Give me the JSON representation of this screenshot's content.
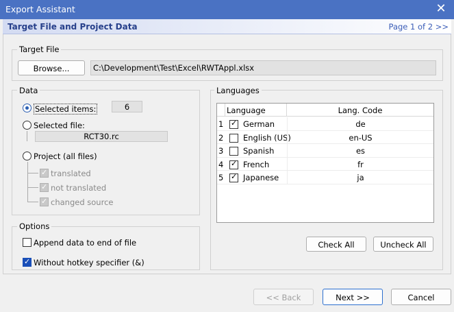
{
  "window": {
    "title": "Export Assistant",
    "close_glyph": "✕"
  },
  "header": {
    "title": "Target File and Project Data",
    "page": "Page 1 of 2",
    "page_arrow": ">>"
  },
  "target_file": {
    "label": "Target File",
    "browse_label": "Browse...",
    "path": "C:\\Development\\Test\\Excel\\RWTAppl.xlsx"
  },
  "data": {
    "label": "Data",
    "selected_items_label": "Selected items:",
    "selected_items_count": "6",
    "selected_file_label": "Selected file:",
    "selected_file_value": "RCT30.rc",
    "project_label": "Project (all files)",
    "translated_label": "translated",
    "not_translated_label": "not translated",
    "changed_source_label": "changed source",
    "selected_mode": "Selected items:"
  },
  "options": {
    "label": "Options",
    "append_label": "Append data to end of file",
    "append_checked": false,
    "hotkey_label": "Without hotkey specifier (&)",
    "hotkey_checked": true
  },
  "languages": {
    "label": "Languages",
    "col_language": "Language",
    "col_code": "Lang. Code",
    "rows": [
      {
        "num": "1",
        "checked": true,
        "name": "German",
        "code": "de"
      },
      {
        "num": "2",
        "checked": false,
        "name": "English (US)",
        "code": "en-US"
      },
      {
        "num": "3",
        "checked": false,
        "name": "Spanish",
        "code": "es"
      },
      {
        "num": "4",
        "checked": true,
        "name": "French",
        "code": "fr"
      },
      {
        "num": "5",
        "checked": true,
        "name": "Japanese",
        "code": "ja"
      }
    ],
    "check_all_label": "Check All",
    "uncheck_all_label": "Uncheck All"
  },
  "footer": {
    "back_label": "<< Back",
    "next_label": "Next >>",
    "cancel_label": "Cancel"
  }
}
